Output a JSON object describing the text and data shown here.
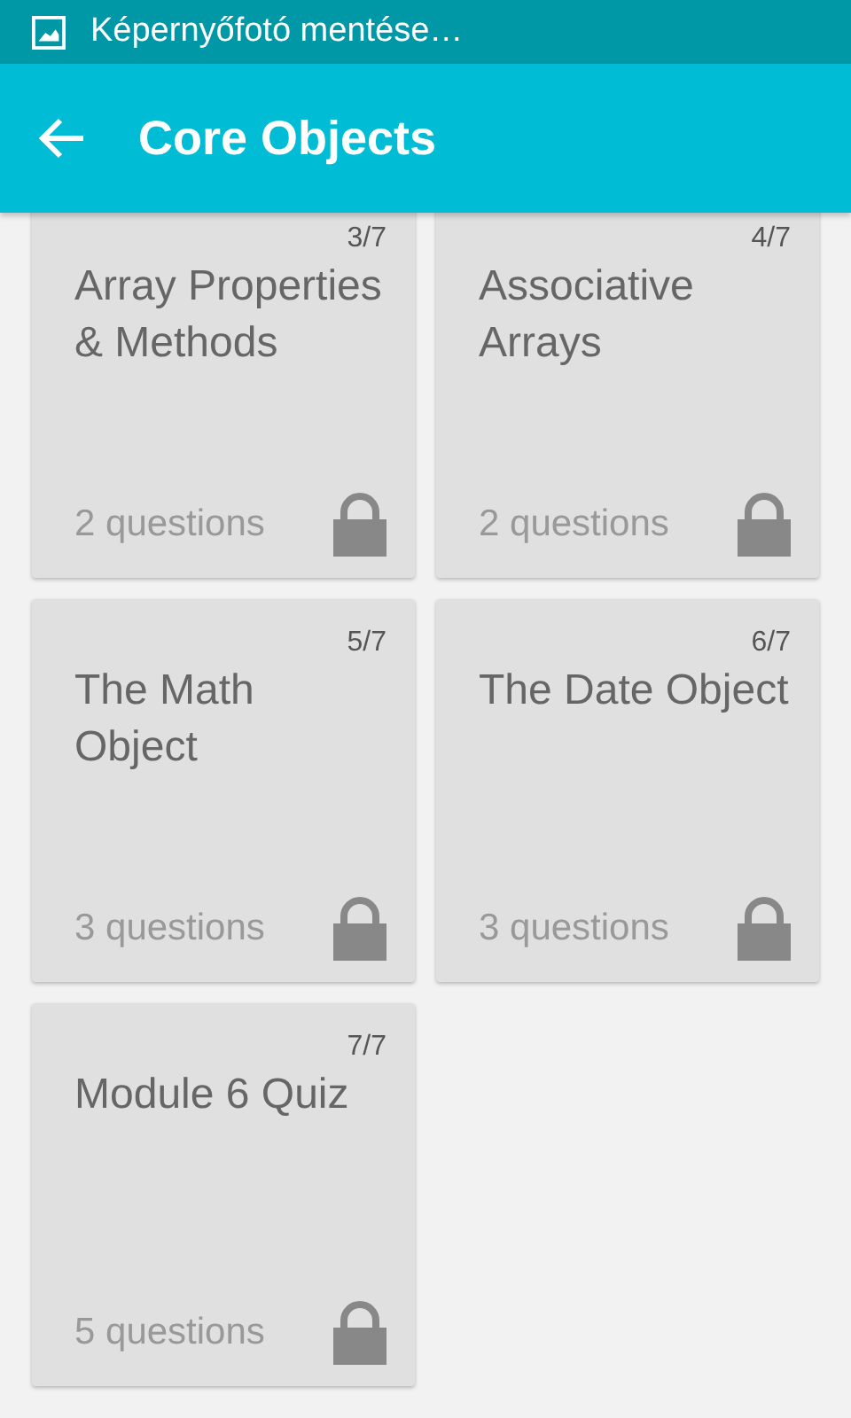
{
  "status_bar": {
    "notification": "Képernyőfotó mentése…"
  },
  "app_bar": {
    "title": "Core Objects"
  },
  "cards": [
    {
      "number": "3/7",
      "title": "Array Properties & Methods",
      "questions": "2 questions",
      "locked": true
    },
    {
      "number": "4/7",
      "title": "Associative Arrays",
      "questions": "2 questions",
      "locked": true
    },
    {
      "number": "5/7",
      "title": "The Math Object",
      "questions": "3 questions",
      "locked": true
    },
    {
      "number": "6/7",
      "title": "The Date Object",
      "questions": "3 questions",
      "locked": true
    },
    {
      "number": "7/7",
      "title": "Module 6 Quiz",
      "questions": "5 questions",
      "locked": true
    }
  ]
}
